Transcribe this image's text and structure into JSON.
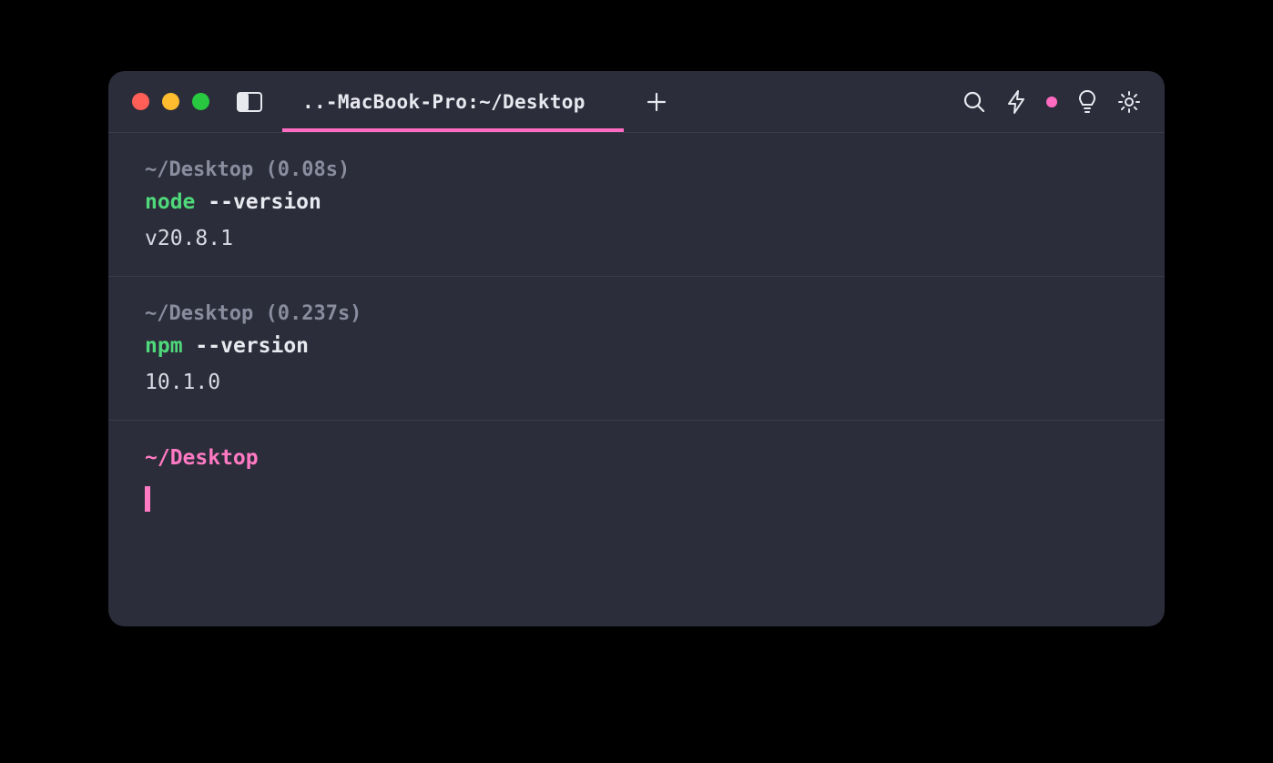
{
  "window": {
    "tab_title": "..-MacBook-Pro:~/Desktop"
  },
  "blocks": [
    {
      "context_path": "~/Desktop",
      "context_timing": "(0.08s)",
      "command": "node",
      "args": "--version",
      "output": "v20.8.1"
    },
    {
      "context_path": "~/Desktop",
      "context_timing": "(0.237s)",
      "command": "npm",
      "args": "--version",
      "output": "10.1.0"
    }
  ],
  "prompt": {
    "path": "~/Desktop"
  },
  "icons": {
    "panels": "panels-icon",
    "plus": "plus-icon",
    "search": "search-icon",
    "bolt": "bolt-icon",
    "dot": "status-dot",
    "bulb": "lightbulb-icon",
    "gear": "gear-icon"
  }
}
